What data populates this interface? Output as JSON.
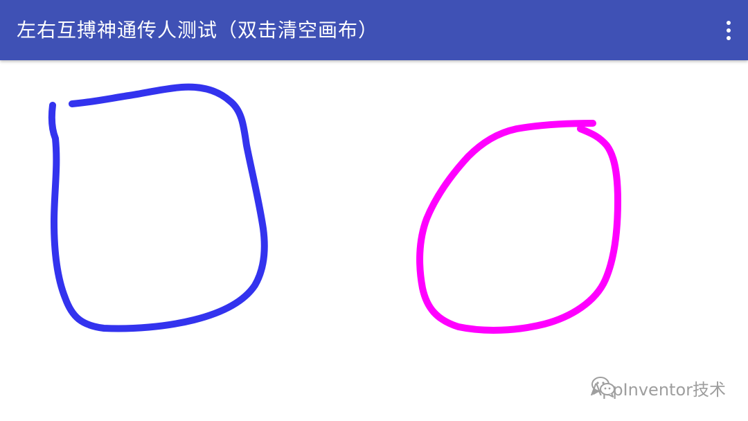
{
  "app_bar": {
    "title": "左右互搏神通传人测试（双击清空画布）",
    "menu_icon": "more-vert-icon",
    "color": "#3F51B5"
  },
  "canvas": {
    "background": "#FFFFFF",
    "strokes": [
      {
        "name": "blue-stroke",
        "color": "#3333EE"
      },
      {
        "name": "magenta-stroke",
        "color": "#FF00FF"
      }
    ]
  },
  "watermark": {
    "icon": "wechat-icon",
    "text": "AppInventor技术"
  }
}
